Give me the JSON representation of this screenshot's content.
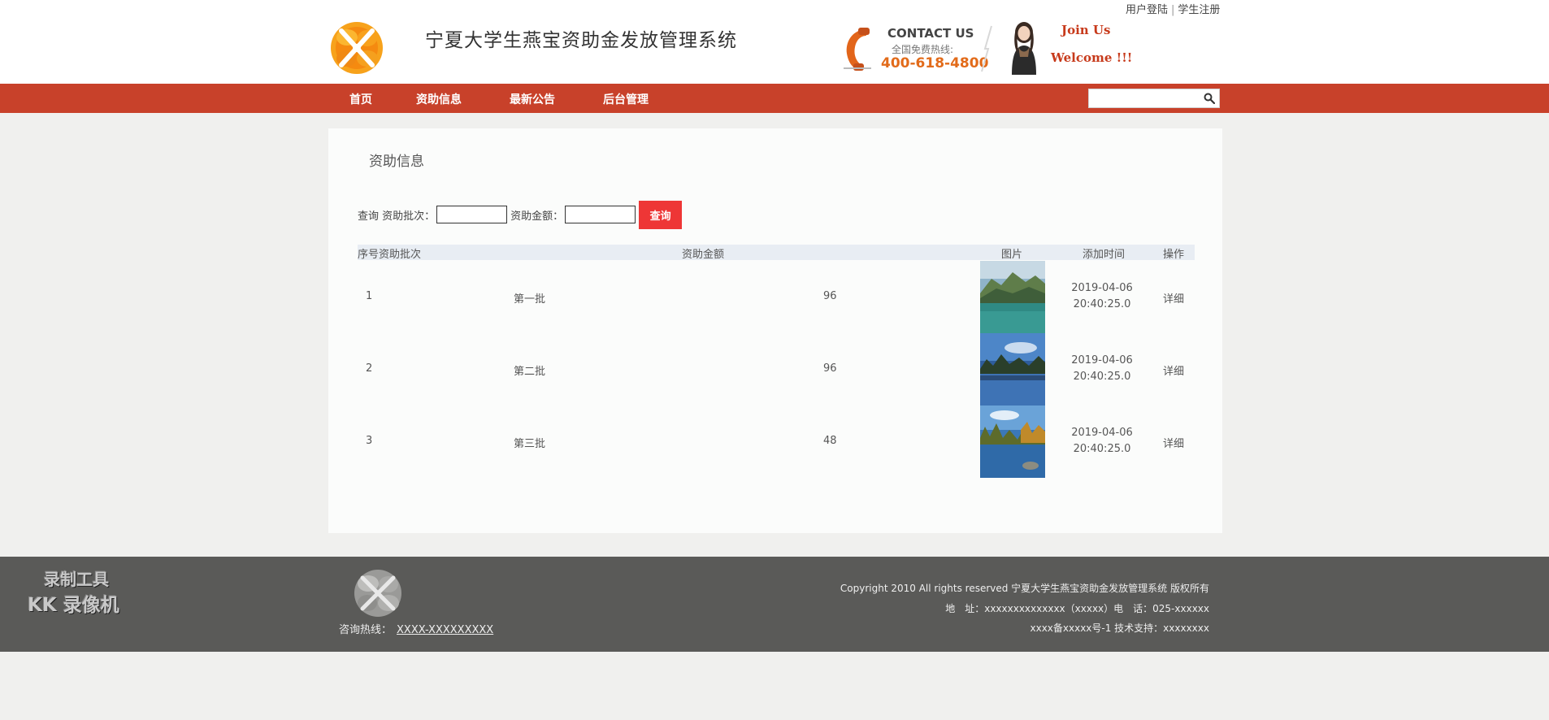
{
  "top_links": {
    "login": "用户登陆",
    "separator": "|",
    "register": "学生注册"
  },
  "header": {
    "site_title": "宁夏大学生燕宝资助金发放管理系统",
    "contact_title": "CONTACT US",
    "contact_sub": "全国免费热线:",
    "contact_number": "400-618-4800",
    "join_line1": "Join Us",
    "join_line2": "Welcome !!!"
  },
  "nav": {
    "items": [
      {
        "label": "首页"
      },
      {
        "label": "资助信息"
      },
      {
        "label": "最新公告"
      },
      {
        "label": "后台管理"
      }
    ],
    "search_value": ""
  },
  "main": {
    "page_title": "资助信息",
    "query": {
      "prefix": "查询",
      "batch_label": "资助批次：",
      "batch_value": "",
      "amount_label": "资助金额：",
      "amount_value": "",
      "button_label": "查询"
    },
    "table": {
      "headers": [
        "序号",
        "资助批次",
        "资助金额",
        "图片",
        "添加时间",
        "操作"
      ],
      "rows": [
        {
          "index": "1",
          "batch": "第一批",
          "amount": "96",
          "date": "2019-04-06",
          "time": "20:40:25.0",
          "action": "详细"
        },
        {
          "index": "2",
          "batch": "第二批",
          "amount": "96",
          "date": "2019-04-06",
          "time": "20:40:25.0",
          "action": "详细"
        },
        {
          "index": "3",
          "batch": "第三批",
          "amount": "48",
          "date": "2019-04-06",
          "time": "20:40:25.0",
          "action": "详细"
        }
      ]
    }
  },
  "footer": {
    "hotline_label": "咨询热线：",
    "hotline_number": "XXXX-XXXXXXXXX",
    "copyright": "Copyright 2010 All rights reserved 宁夏大学生燕宝资助金发放管理系统 版权所有",
    "address": "地　址：xxxxxxxxxxxxxx（xxxxx）电　话：025-xxxxxx",
    "icp": "xxxx备xxxxx号-1 技术支持：xxxxxxxx",
    "watermark_line1": "录制工具",
    "watermark_line2": "KK 录像机"
  },
  "colors": {
    "nav_bg": "#c8412a",
    "query_button": "#ee3636",
    "footer_bg": "#5a5a58",
    "contact_number": "#e26b1a",
    "join_text": "#c73a1b"
  }
}
